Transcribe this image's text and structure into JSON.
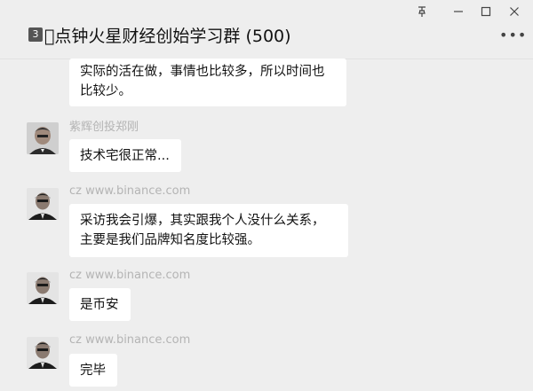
{
  "window": {
    "pin_icon": "pin-icon",
    "minimize_icon": "minimize-icon",
    "maximize_icon": "maximize-icon",
    "close_icon": "close-icon"
  },
  "header": {
    "badge": "3",
    "title": "\u0000点钟火星财经创始学习群 (500)",
    "more_icon": "more-icon"
  },
  "messages": [
    {
      "sender": "",
      "text": "实际的活在做，事情也比较多，所以时间也\n比较少。"
    },
    {
      "sender": "紫辉创投郑刚",
      "text": "技术宅很正常..."
    },
    {
      "sender": "cz www.binance.com",
      "text": "采访我会引爆，其实跟我个人没什么关系，\n主要是我们品牌知名度比较强。"
    },
    {
      "sender": "cz www.binance.com",
      "text": "是币安"
    },
    {
      "sender": "cz www.binance.com",
      "text": "完毕"
    }
  ]
}
